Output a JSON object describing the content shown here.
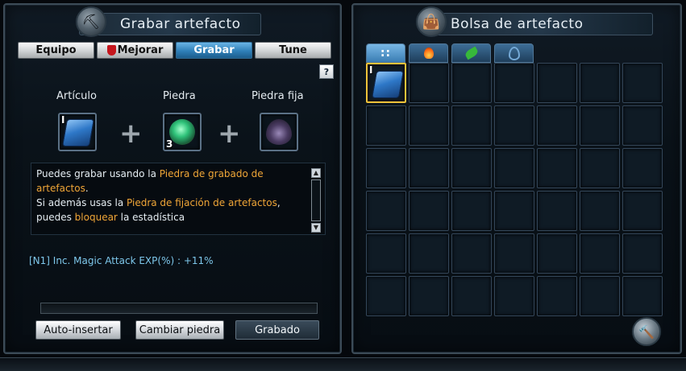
{
  "left": {
    "title": "Grabar artefacto",
    "tabs": [
      {
        "label": "Equipo",
        "active": false
      },
      {
        "label": "Mejorar",
        "active": false
      },
      {
        "label": "Grabar",
        "active": true
      },
      {
        "label": "Tune",
        "active": false
      }
    ],
    "help": "?",
    "slots": [
      {
        "label": "Artículo",
        "count": "I"
      },
      {
        "label": "Piedra",
        "count": "3"
      },
      {
        "label": "Piedra fija",
        "count": ""
      }
    ],
    "description": {
      "p1": "Puedes grabar usando la ",
      "h1": "Piedra de grabado de artefactos",
      "p2": ".",
      "p3": "Si además usas la ",
      "h2": "Piedra de fijación de artefactos",
      "p4": ", puedes ",
      "h3": "bloquear",
      "p5": " la estadística"
    },
    "stat_line": "[N1] Inc. Magic Attack EXP(%) : +11%",
    "progress_percent": 0,
    "buttons": {
      "auto_insert": "Auto-insertar",
      "change_stone": "Cambiar piedra",
      "engrave": "Grabado"
    }
  },
  "right": {
    "title": "Bolsa de artefacto",
    "tabs": [
      "all",
      "fire",
      "nature",
      "water"
    ],
    "first_item_count": "I",
    "colors": {
      "selected_border": "#f1c33a",
      "active_tab": "#3a7db3",
      "highlight_text": "#f0a637"
    }
  }
}
